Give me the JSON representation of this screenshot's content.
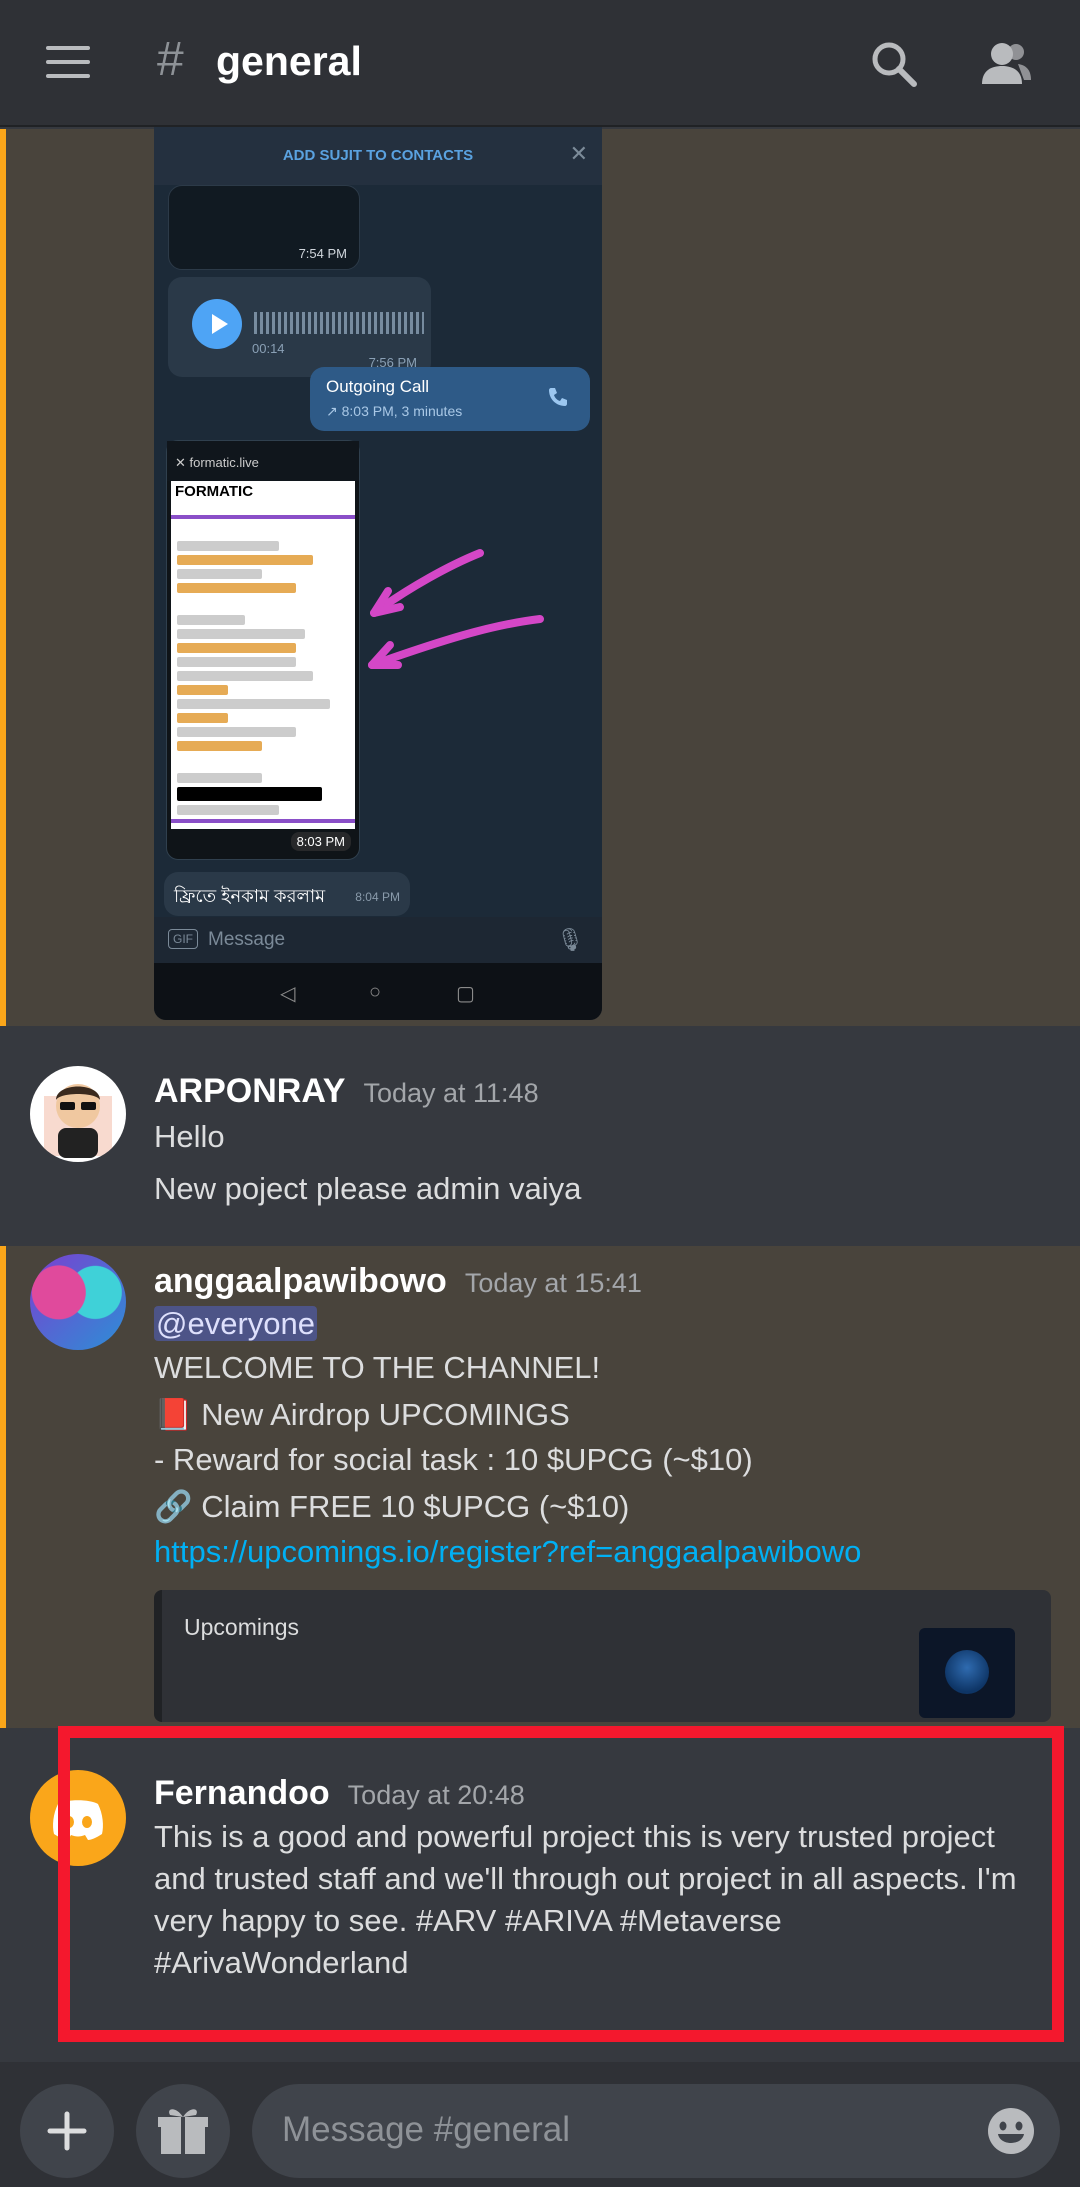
{
  "header": {
    "hash": "#",
    "channel_name": "general"
  },
  "screenshot": {
    "add_contacts": "ADD SUJIT TO CONTACTS",
    "time1": "7:54 PM",
    "voice_duration": "00:14",
    "time2": "7:56 PM",
    "call_title": "Outgoing Call",
    "call_detail": "↗ 8:03 PM, 3 minutes",
    "site": "formatic.live",
    "page_head": "FORMATIC",
    "time3": "8:03 PM",
    "bengali": "ফ্রিতে ইনকাম করলাম",
    "time4": "8:04 PM",
    "message_placeholder": "Message"
  },
  "messages": [
    {
      "username": "ARPONRAY",
      "timestamp": "Today at 11:48",
      "lines": [
        "Hello",
        "New poject please admin vaiya"
      ]
    },
    {
      "username": "anggaalpawibowo",
      "timestamp": "Today at 15:41",
      "mention": "@everyone",
      "lines": [
        "WELCOME TO THE CHANNEL!",
        "📕 New Airdrop UPCOMINGS",
        "- Reward for social task : 10 $UPCG (~$10)",
        "🔗 Claim FREE 10 $UPCG (~$10)"
      ],
      "link": "https://upcomings.io/register?ref=anggaalpawibowo",
      "embed_title": "Upcomings"
    },
    {
      "username": "Fernandoo",
      "timestamp": "Today at 20:48",
      "text": "This is a good and powerful project this is very trusted project and trusted staff and we'll through out project in all aspects. I'm very happy to see. #ARV #ARIVA #Metaverse #ArivaWonderland"
    }
  ],
  "composer": {
    "placeholder": "Message #general"
  },
  "colors": {
    "mention_highlight": "#49443c",
    "mention_bar": "#faa61a",
    "highlight_box": "#f4182d",
    "link": "#00b0f4"
  }
}
